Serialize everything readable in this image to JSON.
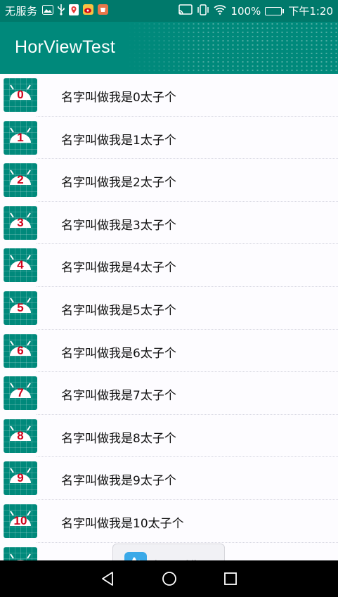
{
  "status_bar": {
    "carrier": "无服务",
    "battery_percent": "100%",
    "time": "下午1:20",
    "battery_level": 1.0,
    "icons": [
      "image-icon",
      "usb-icon",
      "map-pin-icon",
      "weibo-icon",
      "app-icon",
      "cast-icon",
      "vibrate-icon",
      "wifi-icon",
      "battery-icon"
    ]
  },
  "app_bar": {
    "title": "HorViewTest"
  },
  "colors": {
    "primary": "#00897b",
    "primary_dark": "#00796b",
    "number": "#d0021b"
  },
  "list": {
    "items": [
      {
        "number": "0",
        "label": "名字叫做我是0太子个"
      },
      {
        "number": "1",
        "label": "名字叫做我是1太子个"
      },
      {
        "number": "2",
        "label": "名字叫做我是2太子个"
      },
      {
        "number": "3",
        "label": "名字叫做我是3太子个"
      },
      {
        "number": "4",
        "label": "名字叫做我是4太子个"
      },
      {
        "number": "5",
        "label": "名字叫做我是5太子个"
      },
      {
        "number": "6",
        "label": "名字叫做我是6太子个"
      },
      {
        "number": "7",
        "label": "名字叫做我是7太子个"
      },
      {
        "number": "8",
        "label": "名字叫做我是8太子个"
      },
      {
        "number": "9",
        "label": "名字叫做我是9太子个"
      },
      {
        "number": "10",
        "label": "名字叫做我是10太子个"
      },
      {
        "number": "",
        "label": ""
      }
    ]
  },
  "overlay": {
    "name": "ApowerMirror"
  },
  "nav_bar": {
    "buttons": [
      "back-icon",
      "home-icon",
      "recents-icon"
    ]
  }
}
